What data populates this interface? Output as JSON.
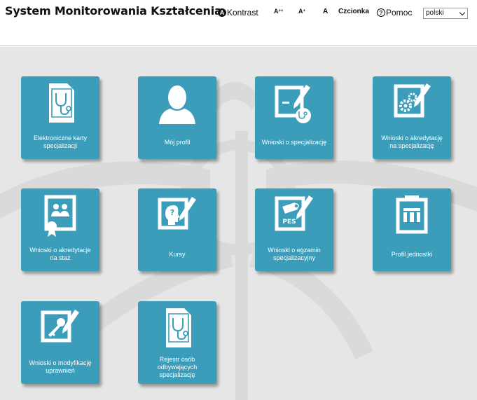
{
  "header": {
    "title": "System Monitorowania Kształcenia",
    "kontrast_label": "Kontrast",
    "font_large": "A",
    "font_large_sup": "++",
    "font_medium": "A",
    "font_medium_sup": "+",
    "font_normal": "A",
    "czcionka_label": "Czcionka",
    "pomoc_label": "Pomoc",
    "language_selected": "polski"
  },
  "colors": {
    "tile": "#3c9dbb",
    "background": "#e6e6e6"
  },
  "tiles": [
    {
      "label": "Elektroniczne karty specjalizacji",
      "icon": "medical-card-icon"
    },
    {
      "label": "Mój profil",
      "icon": "user-profile-icon"
    },
    {
      "label": "Wnioski o specjalizację",
      "icon": "specialization-application-icon"
    },
    {
      "label": "Wnioski o akredytację na specjalizację",
      "icon": "accreditation-gears-icon"
    },
    {
      "label": "Wnioski o akredytacje na staż",
      "icon": "internship-accreditation-icon"
    },
    {
      "label": "Kursy",
      "icon": "course-head-icon"
    },
    {
      "label": "Wnioski o egzamin specjalizacyjny",
      "icon": "exam-pes-icon"
    },
    {
      "label": "Profil jednostki",
      "icon": "building-icon"
    },
    {
      "label": "Wnioski o modyfikację uprawnień",
      "icon": "key-permissions-icon"
    },
    {
      "label": "Rejestr osób odbywających specjalizację",
      "icon": "medical-card-icon"
    }
  ]
}
